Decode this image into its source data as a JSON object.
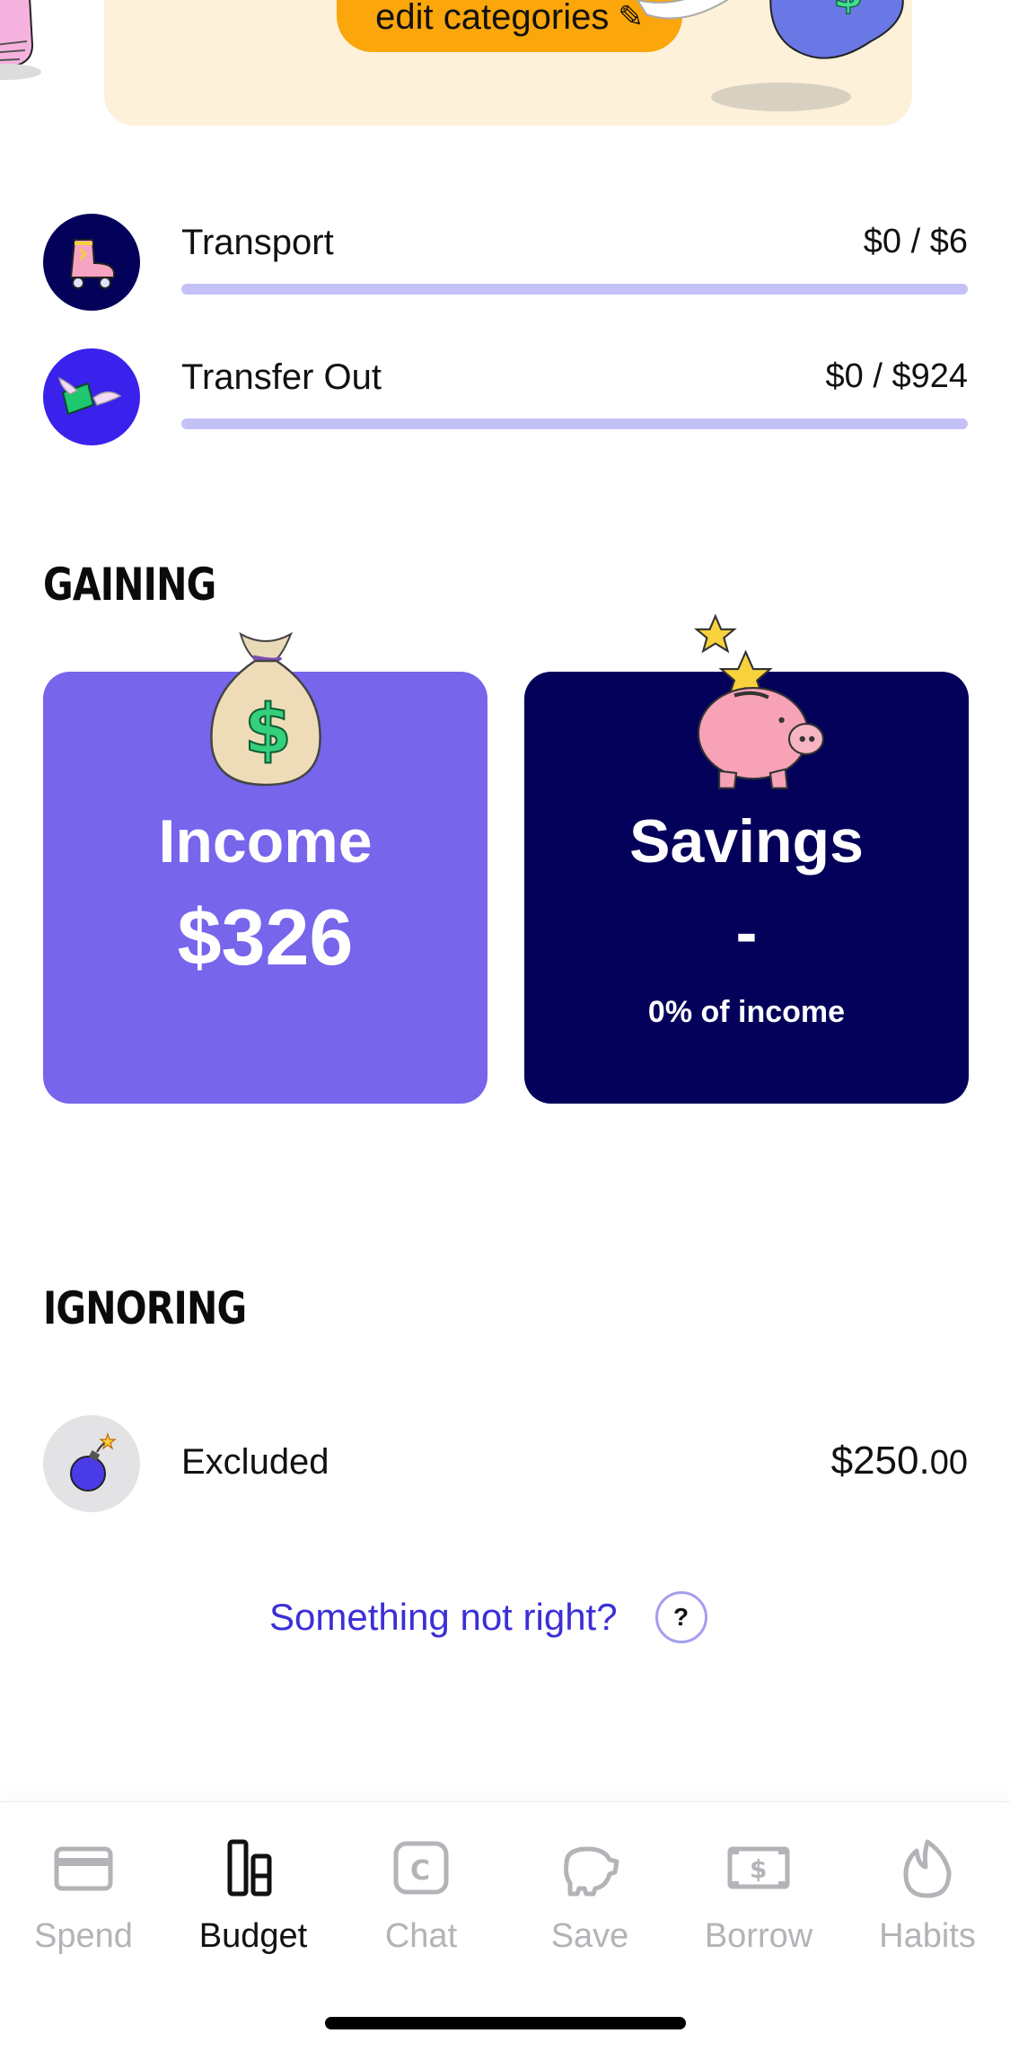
{
  "banner": {
    "edit_label": "edit categories"
  },
  "categories": [
    {
      "name": "Transport",
      "amount": "$0 / $6",
      "progress": 0,
      "icon": "roller-skate-icon",
      "icon_bg": "#04015a"
    },
    {
      "name": "Transfer Out",
      "amount": "$0 / $924",
      "progress": 0,
      "icon": "flying-money-icon",
      "icon_bg": "#3a22ec"
    }
  ],
  "gaining": {
    "title": "GAINING",
    "income": {
      "title": "Income",
      "value": "$326",
      "color": "#7765ec",
      "icon": "money-bag-icon"
    },
    "savings": {
      "title": "Savings",
      "value": "-",
      "subtitle": "0% of income",
      "color": "#04015a",
      "icon": "piggy-bank-icon"
    }
  },
  "ignoring": {
    "title": "IGNORING",
    "item": {
      "name": "Excluded",
      "amount_main": "$250.",
      "amount_cents": "00",
      "icon": "bomb-icon"
    }
  },
  "help": {
    "text": "Something not right?",
    "icon_label": "?"
  },
  "tabs": [
    {
      "label": "Spend",
      "icon": "credit-card-icon",
      "active": false
    },
    {
      "label": "Budget",
      "icon": "budget-bars-icon",
      "active": true
    },
    {
      "label": "Chat",
      "icon": "chat-coin-icon",
      "active": false
    },
    {
      "label": "Save",
      "icon": "piggy-bank-icon",
      "active": false
    },
    {
      "label": "Borrow",
      "icon": "banknote-icon",
      "active": false
    },
    {
      "label": "Habits",
      "icon": "flame-icon",
      "active": false
    }
  ],
  "colors": {
    "accent": "#3b2fd6",
    "progress_track": "#c4c1f7",
    "banner": "#fdf1da",
    "edit_button": "#fba60a"
  }
}
